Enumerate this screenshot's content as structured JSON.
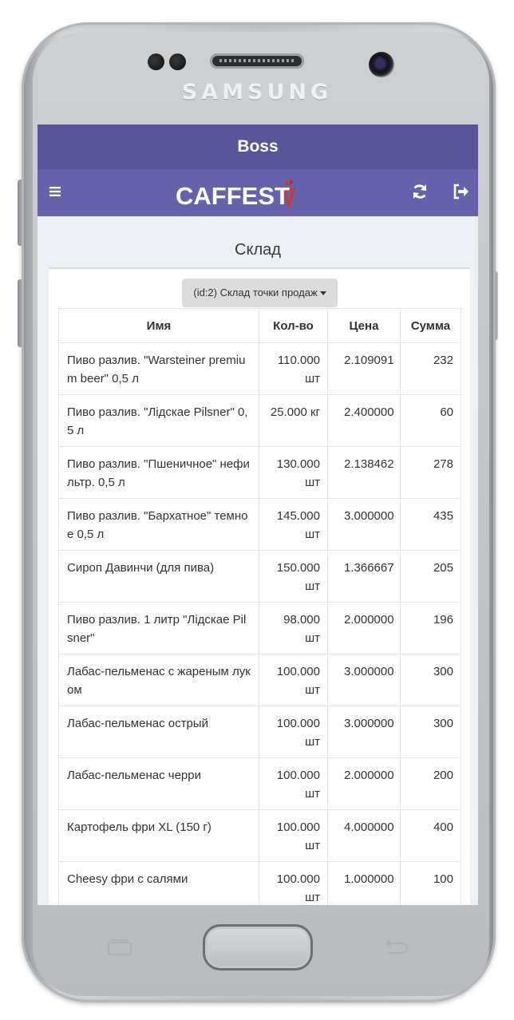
{
  "device": {
    "brand": "SAMSUNG"
  },
  "header": {
    "title": "Boss"
  },
  "navbar": {
    "logo_text": "CAFFEST",
    "menu_icon": "hamburger-icon",
    "refresh_icon": "refresh-icon",
    "logout_icon": "sign-out-icon"
  },
  "page": {
    "title": "Склад"
  },
  "warehouse_select": {
    "selected": "(id:2) Склад точки продаж"
  },
  "table": {
    "columns": [
      "Имя",
      "Кол-во",
      "Цена",
      "Сумма"
    ],
    "rows": [
      {
        "name": "Пиво разлив. \"Warsteiner premium beer\" 0,5 л",
        "qty": "110.000 шт",
        "price": "2.109091",
        "sum": "232"
      },
      {
        "name": "Пиво разлив. \"Лідскае Pilsner\" 0,5 л",
        "qty": "25.000 кг",
        "price": "2.400000",
        "sum": "60"
      },
      {
        "name": "Пиво разлив. \"Пшеничное\" нефильтр. 0,5 л",
        "qty": "130.000 шт",
        "price": "2.138462",
        "sum": "278"
      },
      {
        "name": "Пиво разлив. \"Бархатное\" темное 0,5 л",
        "qty": "145.000 шт",
        "price": "3.000000",
        "sum": "435"
      },
      {
        "name": "Сироп Давинчи (для пива)",
        "qty": "150.000 шт",
        "price": "1.366667",
        "sum": "205"
      },
      {
        "name": "Пиво разлив. 1 литр \"Лідскае Pilsner\"",
        "qty": "98.000 шт",
        "price": "2.000000",
        "sum": "196"
      },
      {
        "name": "Лабас-пельменас с жареным луком",
        "qty": "100.000 шт",
        "price": "3.000000",
        "sum": "300"
      },
      {
        "name": "Лабас-пельменас острый",
        "qty": "100.000 шт",
        "price": "3.000000",
        "sum": "300"
      },
      {
        "name": "Лабас-пельменас черри",
        "qty": "100.000 шт",
        "price": "2.000000",
        "sum": "200"
      },
      {
        "name": "Картофель фри XL (150 г)",
        "qty": "100.000 шт",
        "price": "4.000000",
        "sum": "400"
      },
      {
        "name": "Cheesy фри с салями",
        "qty": "100.000 шт",
        "price": "1.000000",
        "sum": "100"
      }
    ]
  },
  "colors": {
    "header_bg": "#58559b",
    "navbar_bg": "#6561ad",
    "logo_accent": "#d9342b"
  }
}
